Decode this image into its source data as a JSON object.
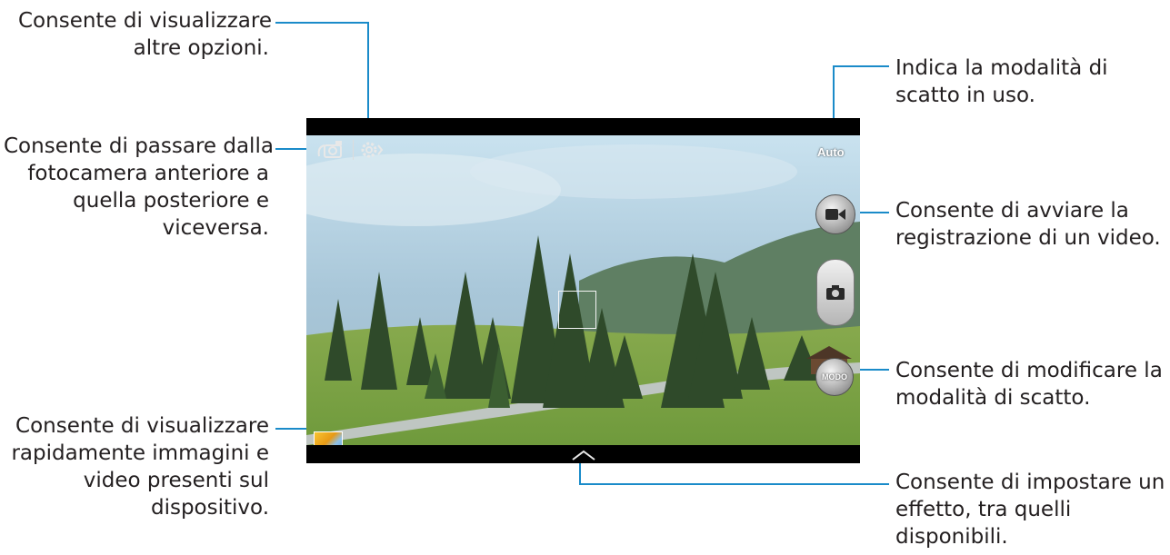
{
  "callouts": {
    "more_options": [
      "Consente di visualizzare",
      "altre opzioni."
    ],
    "switch_camera": [
      "Consente di passare dalla",
      "fotocamera anteriore a",
      "quella posteriore e",
      "viceversa."
    ],
    "gallery": [
      "Consente di visualizzare",
      "rapidamente immagini e",
      "video presenti sul",
      "dispositivo."
    ],
    "shooting_mode": [
      "Indica la modalità di",
      "scatto in uso."
    ],
    "record_video": [
      "Consente di avviare la",
      "registrazione di un video."
    ],
    "change_mode": [
      "Consente di modificare la",
      "modalità di scatto."
    ],
    "effects": [
      "Consente di impostare un",
      "effetto, tra quelli",
      "disponibili."
    ]
  },
  "camera": {
    "mode_label": "Auto",
    "mode_button_label": "MODO"
  },
  "colors": {
    "leader": "#1a8bc9",
    "text": "#231f20"
  },
  "icons": [
    "switch-camera-icon",
    "settings-icon",
    "video-camera-icon",
    "camera-icon",
    "gallery-thumbnail",
    "chevron-up-icon"
  ]
}
